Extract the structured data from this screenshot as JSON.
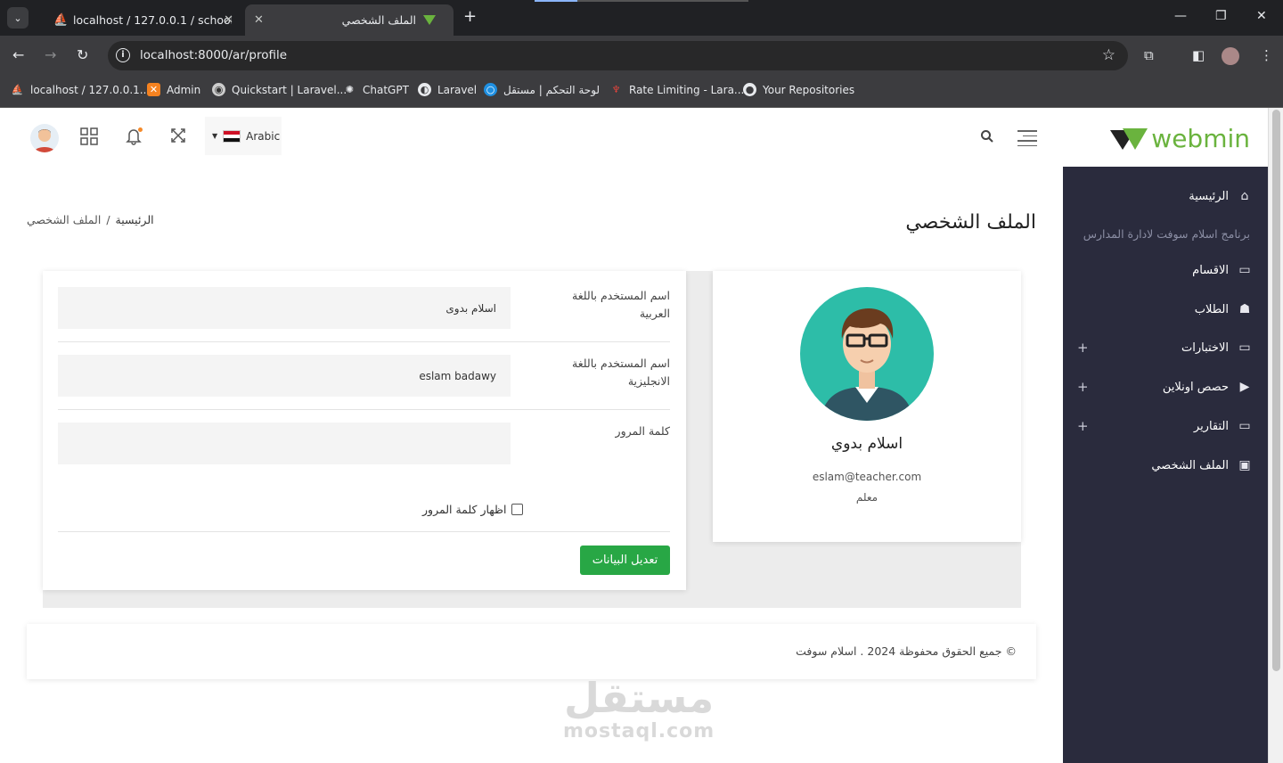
{
  "browser": {
    "tabs": [
      {
        "title": "localhost / 127.0.0.1 / school / s",
        "active": false
      },
      {
        "title": "الملف الشخصي",
        "active": true
      }
    ],
    "url": "localhost:8000/ar/profile",
    "bookmarks": [
      "localhost / 127.0.0.1...",
      "Admin",
      "Quickstart | Laravel...",
      "ChatGPT",
      "Laravel",
      "لوحة التحكم | مستقل",
      "Rate Limiting - Lara...",
      "Your Repositories"
    ]
  },
  "topbar": {
    "logo_text": "webmin",
    "language": "Arabic"
  },
  "sidebar": {
    "subtitle": "برنامج اسلام سوفت لادارة المدارس",
    "items": [
      {
        "label": "الرئيسية",
        "icon": "home-icon",
        "expandable": false
      },
      {
        "label": "الاقسام",
        "icon": "laptop-icon",
        "expandable": false
      },
      {
        "label": "الطلاب",
        "icon": "graduate-icon",
        "expandable": false
      },
      {
        "label": "الاختبارات",
        "icon": "laptop-icon",
        "expandable": true
      },
      {
        "label": "حصص اونلاين",
        "icon": "video-icon",
        "expandable": true
      },
      {
        "label": "التقارير",
        "icon": "laptop-icon",
        "expandable": true
      },
      {
        "label": "الملف الشخصي",
        "icon": "id-badge-icon",
        "expandable": false
      }
    ],
    "expand_symbol": "+"
  },
  "page": {
    "title": "الملف الشخصي",
    "breadcrumb": {
      "home": "الرئيسية",
      "separator": "/",
      "current": "الملف الشخصي"
    }
  },
  "profile": {
    "name": "اسلام بدوي",
    "email": "eslam@teacher.com",
    "role": "معلم"
  },
  "form": {
    "name_ar_label": "اسم المستخدم باللغة العربية",
    "name_ar_value": "اسلام بدوى",
    "name_en_label": "اسم المستخدم باللغة الانجليزية",
    "name_en_value": "eslam badawy",
    "password_label": "كلمة المرور",
    "password_value": "",
    "show_password_label": "اظهار كلمة المرور",
    "show_password_checked": false,
    "submit_label": "تعديل البيانات"
  },
  "footer": {
    "text": "© جميع الحقوق محفوظة 2024 . اسلام سوفت"
  },
  "watermark": {
    "ar": "مستقل",
    "en": "mostaql.com"
  },
  "colors": {
    "brand": "#6ab33e",
    "sidebar_bg": "#2a2b3d",
    "button_green": "#28a745",
    "avatar_bg": "#2dbda8"
  }
}
